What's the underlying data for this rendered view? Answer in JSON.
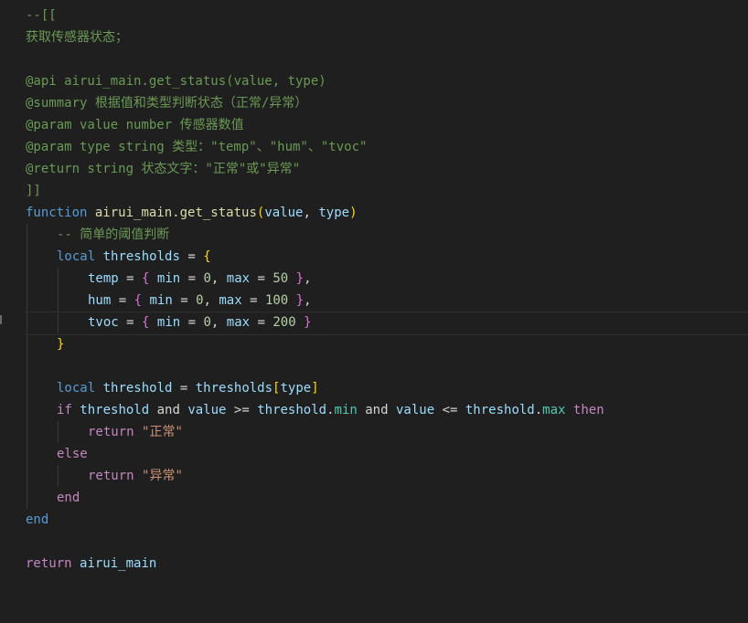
{
  "code": {
    "l1": "--[[",
    "l2": "获取传感器状态；",
    "l4": "@api airui_main.get_status(value, type)",
    "l5": "@summary 根据值和类型判断状态（正常/异常）",
    "l6": "@param value number 传感器数值",
    "l7": "@param type string 类型：\"temp\"、\"hum\"、\"tvoc\"",
    "l8": "@return string 状态文字：\"正常\"或\"异常\"",
    "l9": "]]",
    "kw_function": "function",
    "fn_name": "airui_main.get_status",
    "p_open": "(",
    "p_value": "value",
    "comma": ", ",
    "p_type": "type",
    "p_close": ")",
    "comment_simple": "-- 简单的阈值判断",
    "kw_local": "local",
    "v_thresholds": "thresholds",
    "eq": " = ",
    "brace_open": "{",
    "brace_close": "}",
    "k_temp": "temp",
    "k_hum": "hum",
    "k_tvoc": "tvoc",
    "k_min": "min",
    "k_max": "max",
    "n_0": "0",
    "n_50": "50",
    "n_100": "100",
    "n_200": "200",
    "v_threshold": "threshold",
    "bracket_open": "[",
    "bracket_close": "]",
    "kw_if": "if",
    "kw_and": "and",
    "op_ge": ">=",
    "op_le": "<=",
    "dot": ".",
    "kw_then": "then",
    "kw_return": "return",
    "s_normal": "\"正常\"",
    "kw_else": "else",
    "s_abnormal": "\"异常\"",
    "kw_end": "end",
    "v_airui_main": "airui_main"
  },
  "colors": {
    "background": "#1f1f1f",
    "comment": "#6a9955",
    "keyword": "#569cd6",
    "control": "#c586c0",
    "function": "#dcdcaa",
    "variable": "#9cdcfe",
    "number": "#b5cea8",
    "string": "#ce9178"
  }
}
